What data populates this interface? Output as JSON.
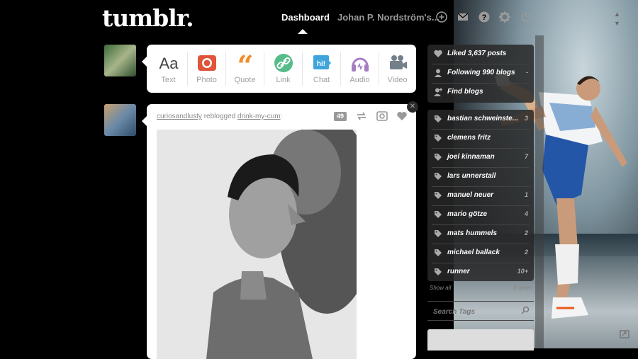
{
  "header": {
    "logo": "tumblr.",
    "dashboard_label": "Dashboard",
    "user_label": "Johan P. Nordström's...",
    "icons": [
      "plus-icon",
      "mail-icon",
      "help-icon",
      "gear-icon",
      "power-icon"
    ]
  },
  "composer": {
    "types": [
      {
        "label": "Text",
        "icon": "text-icon",
        "color": "#444444"
      },
      {
        "label": "Photo",
        "icon": "camera-icon",
        "color": "#e0543a"
      },
      {
        "label": "Quote",
        "icon": "quote-icon",
        "color": "#f28c28"
      },
      {
        "label": "Link",
        "icon": "link-icon",
        "color": "#56bc8a"
      },
      {
        "label": "Chat",
        "icon": "chat-icon",
        "color": "#3ea5dc"
      },
      {
        "label": "Audio",
        "icon": "headphones-icon",
        "color": "#a77dc2"
      },
      {
        "label": "Video",
        "icon": "video-camera-icon",
        "color": "#748089"
      }
    ]
  },
  "post": {
    "author": "curiosandlusty",
    "action": "reblogged",
    "source": "drink-my-cum",
    "suffix": ":",
    "note_count": "49"
  },
  "sidebar": {
    "top": [
      {
        "label": "Liked 3,637 posts",
        "icon": "heart-icon",
        "count": ""
      },
      {
        "label": "Following 990 blogs",
        "icon": "person-icon",
        "count": "-"
      },
      {
        "label": "Find blogs",
        "icon": "add-person-icon",
        "count": ""
      }
    ],
    "tags": [
      {
        "label": "bastian schweinste...",
        "count": "3"
      },
      {
        "label": "clemens fritz",
        "count": ""
      },
      {
        "label": "joel kinnaman",
        "count": "7"
      },
      {
        "label": "lars unnerstall",
        "count": ""
      },
      {
        "label": "manuel neuer",
        "count": "1"
      },
      {
        "label": "mario götze",
        "count": "4"
      },
      {
        "label": "mats hummels",
        "count": "2"
      },
      {
        "label": "michael ballack",
        "count": "2"
      },
      {
        "label": "runner",
        "count": "10+"
      }
    ],
    "show_all": "Show all",
    "explore": "Explore",
    "search_placeholder": "Search Tags"
  }
}
